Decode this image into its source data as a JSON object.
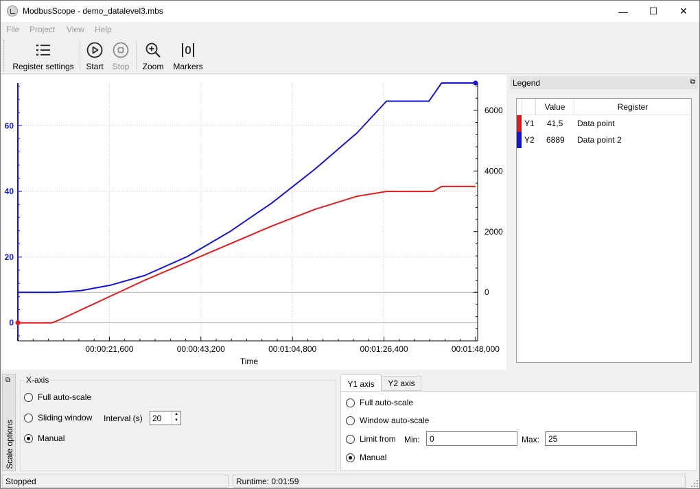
{
  "window": {
    "title": "ModbusScope - demo_datalevel3.mbs"
  },
  "window_controls": {
    "minimize": "—",
    "maximize": "☐",
    "close": "✕"
  },
  "menu": [
    "File",
    "Project",
    "View",
    "Help"
  ],
  "toolbar": {
    "register_settings": "Register settings",
    "start": "Start",
    "stop": "Stop",
    "zoom": "Zoom",
    "markers": "Markers"
  },
  "chart_data": {
    "type": "line",
    "xlabel": "Time",
    "x_ticks": [
      "00:00:21,600",
      "00:00:43,200",
      "00:01:04,800",
      "00:01:26,400",
      "00:01:48,000"
    ],
    "y1_ticks": [
      "0",
      "20",
      "40",
      "60"
    ],
    "y2_ticks": [
      "0",
      "2000",
      "4000",
      "6000"
    ],
    "x_seconds_range": [
      0,
      108.5
    ],
    "y1_range": [
      -5.5,
      73
    ],
    "y2_range": [
      -1600,
      6900
    ],
    "grid": true,
    "colors": {
      "Y1": "#e31a1c",
      "Y2": "#1414d2"
    },
    "series": [
      {
        "name": "Data point",
        "axis": "Y1",
        "x": [
          0,
          8,
          10,
          20,
          30,
          40,
          50,
          60,
          70,
          80,
          87,
          98,
          100,
          108
        ],
        "values": [
          0,
          0,
          1,
          7,
          13,
          18.5,
          24,
          29.5,
          34.5,
          38.5,
          40,
          40,
          41.5,
          41.5
        ]
      },
      {
        "name": "Data point 2",
        "axis": "Y2",
        "x": [
          0,
          9,
          15,
          22,
          30,
          40,
          50,
          60,
          70,
          80,
          87,
          97,
          100,
          108
        ],
        "values": [
          0,
          0,
          60,
          240,
          560,
          1180,
          2000,
          2950,
          4050,
          5250,
          6300,
          6300,
          6900,
          6900
        ]
      }
    ]
  },
  "legend": {
    "title": "Legend",
    "columns": [
      "Value",
      "Register"
    ],
    "rows": [
      {
        "axis": "Y1",
        "value": "41,5",
        "register": "Data point",
        "color": "#e31a1c"
      },
      {
        "axis": "Y2",
        "value": "6889",
        "register": "Data point 2",
        "color": "#1414d2"
      }
    ]
  },
  "scale_options": {
    "tab_label": "Scale options",
    "x_axis": {
      "title": "X-axis",
      "full_auto": "Full auto-scale",
      "sliding_window": "Sliding window",
      "interval_label": "Interval (s)",
      "interval_value": "20",
      "manual": "Manual",
      "selected": "manual"
    },
    "y_tabs": [
      "Y1 axis",
      "Y2 axis"
    ],
    "y_axis": {
      "full_auto": "Full auto-scale",
      "window_auto": "Window auto-scale",
      "limit_from": "Limit from",
      "min_label": "Min:",
      "min_value": "0",
      "max_label": "Max:",
      "max_value": "25",
      "manual": "Manual",
      "selected": "manual"
    }
  },
  "status": {
    "state": "Stopped",
    "runtime": "Runtime: 0:01:59"
  }
}
